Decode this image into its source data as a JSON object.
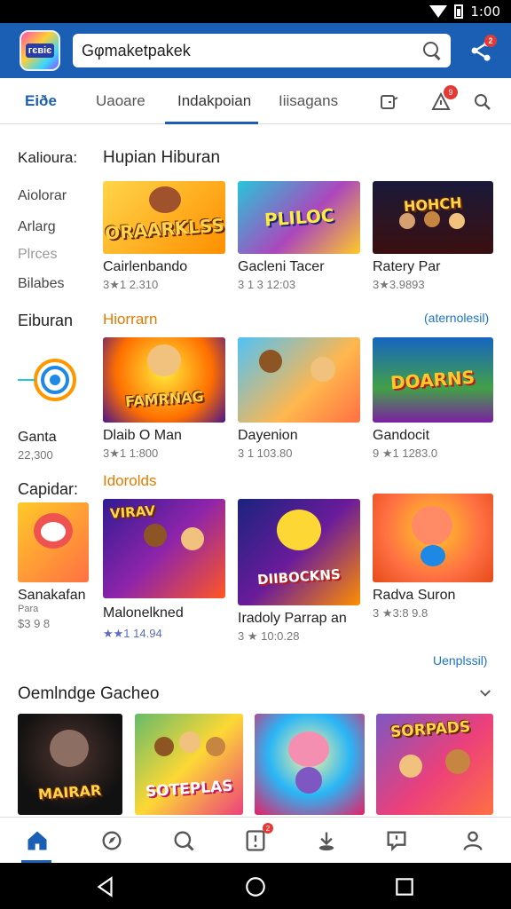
{
  "status_bar": {
    "time": "1:00"
  },
  "app_bar": {
    "logo_text": "гєвіє",
    "search_value": "Gφmaketpakek",
    "share_badge": "2"
  },
  "tabs": [
    {
      "label": "Eiðe"
    },
    {
      "label": "Uaoare"
    },
    {
      "label": "Indakpoian"
    },
    {
      "label": "Iiisagans"
    }
  ],
  "tab_icons": {
    "notif_badge": "9"
  },
  "sidebar": {
    "heading": "Kalioura:",
    "items": [
      {
        "label": "Aiolorar"
      },
      {
        "label": "Arlarg"
      },
      {
        "label": "Plrces"
      },
      {
        "label": "Bilabes"
      }
    ]
  },
  "section_hiburan": {
    "title": "Hupian Hiburan",
    "cards": [
      {
        "name": "Cairlenbando",
        "meta": "3★1 2.310",
        "art": "ORAARKLSS",
        "colors": [
          "#ffb300",
          "#ff6f00"
        ]
      },
      {
        "name": "Gacleni Tacer",
        "meta": "3 1 3 12:03",
        "art": "PLILOC",
        "colors": [
          "#00c2ff",
          "#ff3d9a"
        ]
      },
      {
        "name": "Ratery Par",
        "meta": "3★3.9893",
        "art": "HOHCH",
        "colors": [
          "#1a1a3a",
          "#ff4d00"
        ]
      }
    ]
  },
  "section_eiburan": {
    "side_title": "Eiburan",
    "title": "Hiorrarn",
    "more": "(aternolesil)",
    "side_card": {
      "name": "Ganta",
      "meta": "22,300"
    },
    "cards": [
      {
        "name": "Dlaib O Man",
        "meta": "3★1 1:800",
        "art": "FAMRNAG",
        "colors": [
          "#ff6f00",
          "#6a1b9a"
        ]
      },
      {
        "name": "Dayenion",
        "meta": "3 1 103.80",
        "art": "",
        "colors": [
          "#4fc3f7",
          "#ff8f00"
        ]
      },
      {
        "name": "Gandocit",
        "meta": "9 ★1 1283.0",
        "art": "DOARNS",
        "colors": [
          "#2e7d32",
          "#7b1fa2"
        ]
      }
    ]
  },
  "section_capidar": {
    "side_title": "Capidar:",
    "title": "Idorolds",
    "more": "Uenplssil)",
    "side_card": {
      "name": "Sanakafan",
      "sub": "Para",
      "meta": "$3 9 8"
    },
    "cards": [
      {
        "name": "Malonelkned",
        "meta": "★★1 14.94",
        "art": "VIRAV",
        "colors": [
          "#5e35b1",
          "#ff5722"
        ]
      },
      {
        "name": "Iradoly Parrap an",
        "meta": "3 ★ 10:0.28",
        "art": "DIIBOCKNS",
        "colors": [
          "#283593",
          "#ff9800"
        ]
      },
      {
        "name": "Radva Suron",
        "meta": "3 ★3:8 9.8",
        "art": "",
        "colors": [
          "#ff7043",
          "#ffca28"
        ]
      }
    ]
  },
  "section_gacheo": {
    "title": "Oemlndge Gacheo",
    "cards": [
      {
        "art": "MAIRAR",
        "colors": [
          "#1b1b1b",
          "#ff8f00"
        ]
      },
      {
        "art": "SOTEPLAS",
        "colors": [
          "#4caf50",
          "#e91e63"
        ]
      },
      {
        "art": "",
        "colors": [
          "#29b6f6",
          "#ff5252"
        ]
      },
      {
        "art": "SORPADS",
        "colors": [
          "#7e57c2",
          "#ff7043"
        ]
      }
    ]
  },
  "bottom_nav": {
    "badge": "2"
  },
  "colors": {
    "primary": "#1a5fb4",
    "accent_orange": "#e67a00",
    "link": "#1a73c8",
    "badge": "#e53935"
  }
}
